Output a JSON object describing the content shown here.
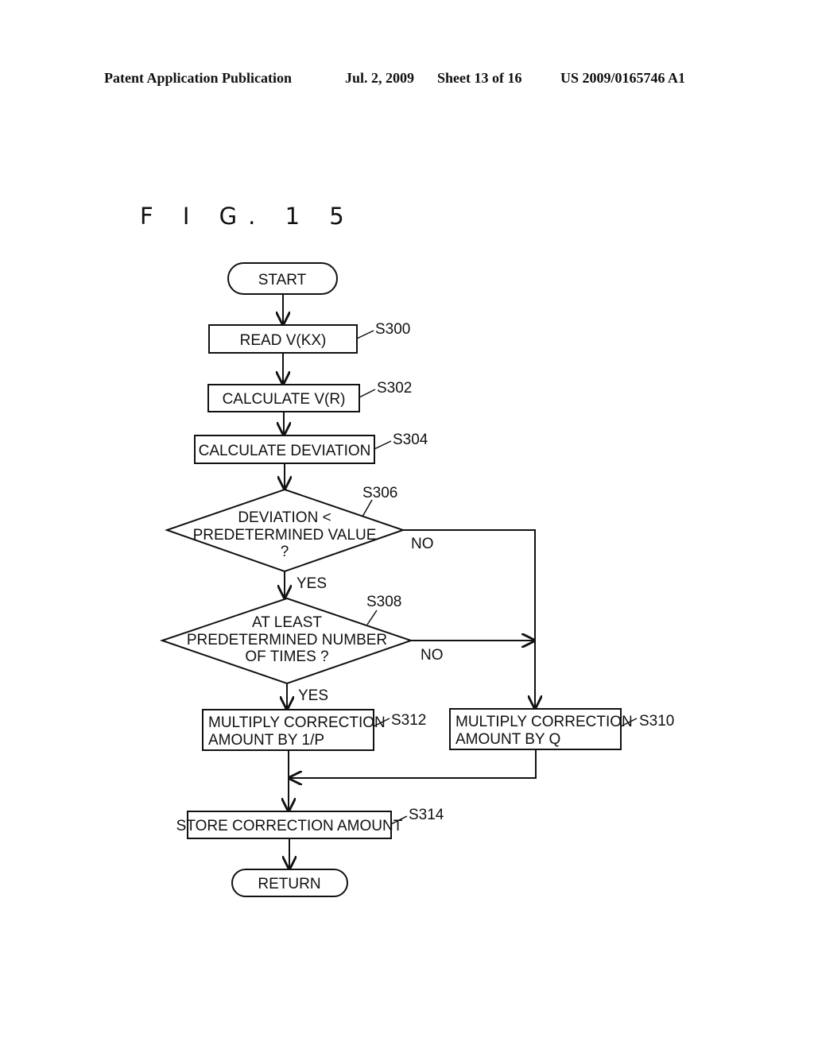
{
  "header": {
    "publication": "Patent Application Publication",
    "date": "Jul. 2, 2009",
    "sheet": "Sheet 13 of 16",
    "number": "US 2009/0165746 A1"
  },
  "figure": {
    "title": "F I G. 1 5"
  },
  "flowchart": {
    "start": "START",
    "end": "RETURN",
    "steps": {
      "s300": {
        "id": "S300",
        "lines": [
          "READ V(KX)"
        ]
      },
      "s302": {
        "id": "S302",
        "lines": [
          "CALCULATE V(R)"
        ]
      },
      "s304": {
        "id": "S304",
        "lines": [
          "CALCULATE DEVIATION"
        ]
      },
      "s306": {
        "id": "S306",
        "lines": [
          "DEVIATION <",
          "PREDETERMINED VALUE",
          "?"
        ]
      },
      "s308": {
        "id": "S308",
        "lines": [
          "AT LEAST",
          "PREDETERMINED NUMBER",
          "OF TIMES ?"
        ]
      },
      "s310": {
        "id": "S310",
        "lines": [
          "MULTIPLY CORRECTION",
          "AMOUNT BY Q"
        ]
      },
      "s312": {
        "id": "S312",
        "lines": [
          "MULTIPLY CORRECTION",
          "AMOUNT BY 1/P"
        ]
      },
      "s314": {
        "id": "S314",
        "lines": [
          "STORE CORRECTION AMOUNT"
        ]
      }
    },
    "branch_labels": {
      "s306_yes": "YES",
      "s306_no": "NO",
      "s308_yes": "YES",
      "s308_no": "NO"
    }
  }
}
